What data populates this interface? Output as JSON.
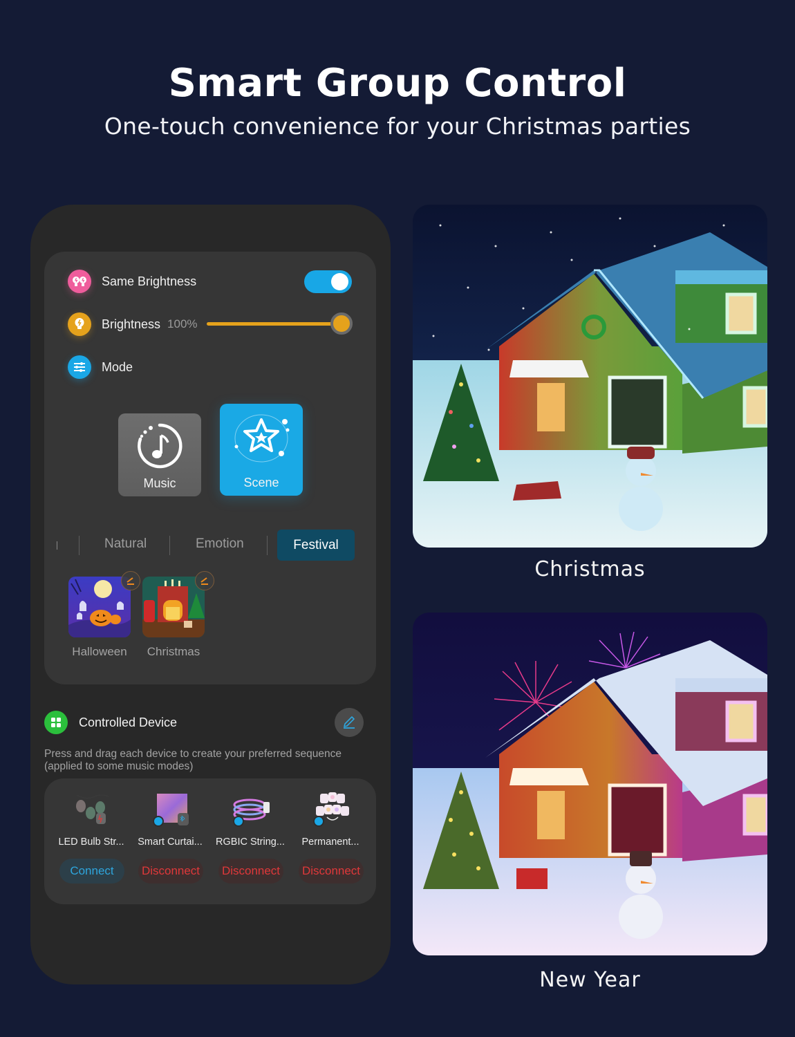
{
  "header": {
    "title": "Smart Group Control",
    "subtitle": "One-touch convenience for your Christmas parties"
  },
  "app": {
    "same_brightness": {
      "label": "Same Brightness",
      "icon": "dual-bulb-icon",
      "enabled": true
    },
    "brightness": {
      "label": "Brightness",
      "value_text": "100%",
      "value": 100,
      "icon": "bulb-icon"
    },
    "mode": {
      "label": "Mode",
      "icon": "sliders-icon",
      "options": [
        {
          "label": "Music",
          "icon": "music-note-icon",
          "selected": false
        },
        {
          "label": "Scene",
          "icon": "star-icon",
          "selected": true
        }
      ]
    },
    "category_tabs": [
      {
        "label": "Natural",
        "active": false
      },
      {
        "label": "Emotion",
        "active": false
      },
      {
        "label": "Festival",
        "active": true
      }
    ],
    "scenes": [
      {
        "label": "Halloween"
      },
      {
        "label": "Christmas"
      }
    ],
    "controlled_device": {
      "title": "Controlled Device",
      "description": "Press and drag each device to create your preferred sequence (applied to some music modes)",
      "devices": [
        {
          "name": "LED Bulb Str...",
          "action": "Connect",
          "status": "disconnected"
        },
        {
          "name": "Smart Curtai...",
          "action": "Disconnect",
          "status": "connected"
        },
        {
          "name": "RGBIC String...",
          "action": "Disconnect",
          "status": "connected"
        },
        {
          "name": "Permanent...",
          "action": "Disconnect",
          "status": "connected"
        }
      ]
    }
  },
  "photos": [
    {
      "caption": "Christmas"
    },
    {
      "caption": "New Year"
    }
  ],
  "colors": {
    "background": "#141b35",
    "accent_blue": "#18a7e6",
    "accent_orange": "#e5a21c",
    "pink": "#ef5d9c",
    "green": "#2bbf3c",
    "disconnect_red": "#e0383a"
  }
}
